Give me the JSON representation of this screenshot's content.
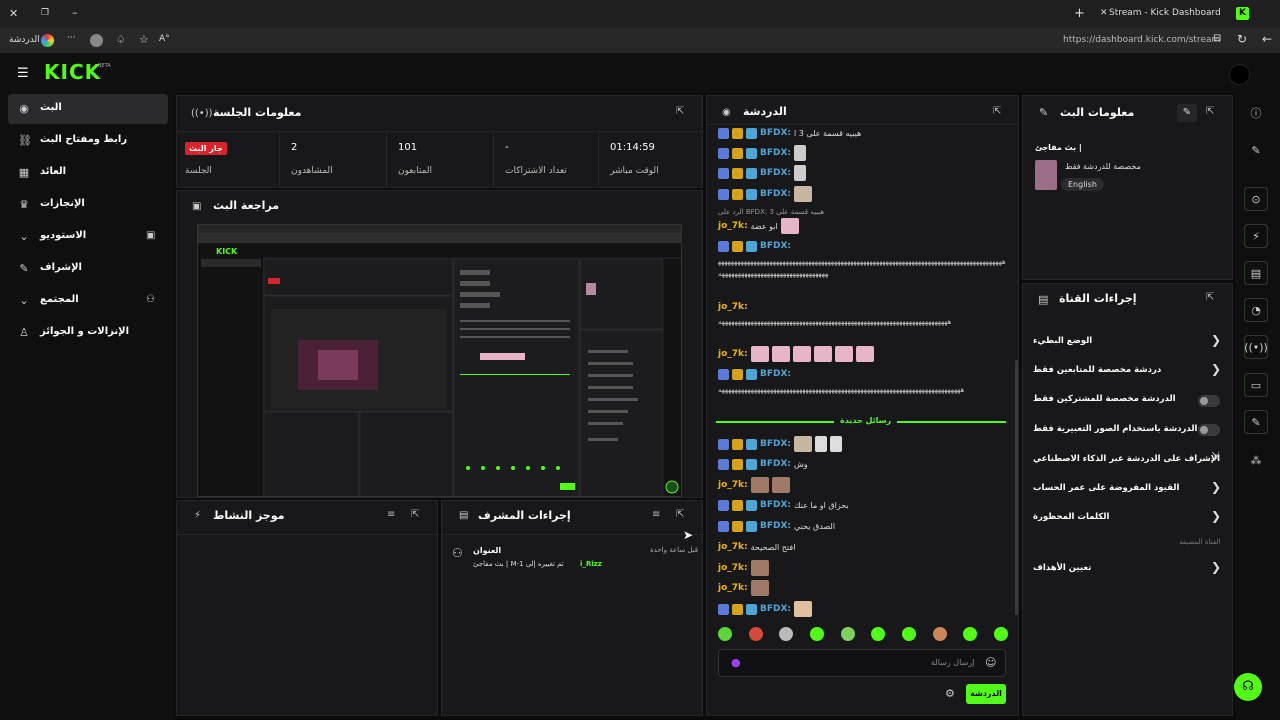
{
  "browser": {
    "tab_title": "Stream - Kick Dashboard",
    "url": "https://dashboard.kick.com/stream",
    "back_label": "الدردشة",
    "icons": [
      "close-icon",
      "restore-icon",
      "minimize-icon",
      "new-tab-icon",
      "kick-favicon",
      "reload-icon",
      "lock-icon",
      "menu-dots-icon",
      "star-icon",
      "read-aloud-icon"
    ]
  },
  "header": {
    "logo": "KICK",
    "logo_badge": "BETA"
  },
  "nav": {
    "items": [
      {
        "label": "البث",
        "icon": "stream-icon"
      },
      {
        "label": "رابط ومفتاح البث",
        "icon": "link-icon"
      },
      {
        "label": "العائد",
        "icon": "grid-icon"
      },
      {
        "label": "الإنجازات",
        "icon": "trophy-icon"
      },
      {
        "label": "الاستوديو",
        "icon": "studio-icon"
      },
      {
        "label": "الإشراف",
        "icon": "wrench-icon"
      },
      {
        "label": "المجتمع",
        "icon": "community-icon"
      },
      {
        "label": "الإنزالات و الجوائز",
        "icon": "drops-icon"
      }
    ]
  },
  "session": {
    "title": "معلومات الجلسة",
    "live_badge": "جار البث",
    "stats": [
      {
        "value": "",
        "label": "الجلسة"
      },
      {
        "value": "2",
        "label": "المشاهدون"
      },
      {
        "value": "101",
        "label": "المتابعون"
      },
      {
        "value": "-",
        "label": "تعداد الاشتراكات"
      },
      {
        "value": "01:14:59",
        "label": "الوقت مباشر"
      }
    ]
  },
  "preview": {
    "title": "مراجعة البث"
  },
  "activity": {
    "title": "موجز النشاط"
  },
  "mod_actions": {
    "title": "إجراءات المشرف",
    "entry_title": "العنوان",
    "entry_time": "قبل ساعة واحدة",
    "entry_text": "بث مفاجئ | M-1 تم تغييره إلى",
    "entry_user": "i_Rizz"
  },
  "chat": {
    "title": "الدردشة",
    "new_messages": "رسائل جديدة",
    "input_placeholder": "إرسال رسالة",
    "send_label": "الدردشة",
    "pinned_top": "هيبيه قسمة على 3 ا",
    "reply_note": "الرد على BFDX: هيبيه قسمة على 3",
    "lines": [
      {
        "user": "BFDX:",
        "text": ""
      },
      {
        "user": "BFDX:",
        "text": ""
      },
      {
        "user": "BFDX:",
        "text": ""
      },
      {
        "user": "jo_7k:",
        "text": "ابو عضة"
      },
      {
        "user": "BFDX:",
        "text": ""
      },
      {
        "user": "jo_7k:",
        "text": ""
      },
      {
        "user": "jo_7k:",
        "text": ""
      },
      {
        "user": "BFDX:",
        "text": ""
      },
      {
        "user": "BFDX:",
        "text": ""
      },
      {
        "user": "BFDX:",
        "text": "وش"
      },
      {
        "user": "jo_7k:",
        "text": ""
      },
      {
        "user": "BFDX:",
        "text": "بحزاق او ما عنك"
      },
      {
        "user": "BFDX:",
        "text": "الصدق يحني"
      },
      {
        "user": "jo_7k:",
        "text": "افتح الصحيحة"
      },
      {
        "user": "jo_7k:",
        "text": ""
      },
      {
        "user": "jo_7k:",
        "text": ""
      },
      {
        "user": "BFDX:",
        "text": ""
      }
    ],
    "long1": "ههههههههههههههههههههههههههههههههههههههههههههههههههههههههههههههههههههههههههههههههههههههههههههههههههههههههههههههههههههههههههه",
    "long2": "هههههههههههههههههههههههههههههههههههههههههههههههههههههههههههههههههههههههه",
    "long3": "هههههههههههههههههههههههههههههههههههههههههههههههههههههههههههههههههههههههههههه"
  },
  "stream_info": {
    "title": "معلومات البث",
    "stream_title": "بث مفاجئ |",
    "category": "مخصصة للدردشة فقط",
    "language": "English"
  },
  "channel_actions": {
    "title": "إجراءات القناة",
    "items": [
      {
        "label": "الوضع البطيء",
        "control": "chevron"
      },
      {
        "label": "دردشة مخصصة للمتابعين فقط",
        "control": "chevron"
      },
      {
        "label": "الدردشة مخصصة للمشتركين فقط",
        "control": "toggle"
      },
      {
        "label": "الدردشة باستخدام الصور التعبيرية فقط",
        "control": "toggle"
      },
      {
        "label": "الإشراف على الدردشة عبر الذكاء الاصطناعي",
        "control": "external"
      },
      {
        "label": "القيود المفروضة على عمر الحساب",
        "control": "chevron"
      },
      {
        "label": "الكلمات المحظورة",
        "control": "chevron"
      }
    ],
    "section_label": "القناة المضيفة",
    "targets_label": "تعيين الأهداف"
  },
  "colors": {
    "accent": "#53fc18",
    "live": "#d7232c",
    "panel": "#18181a",
    "bg": "#0b0b0c"
  }
}
